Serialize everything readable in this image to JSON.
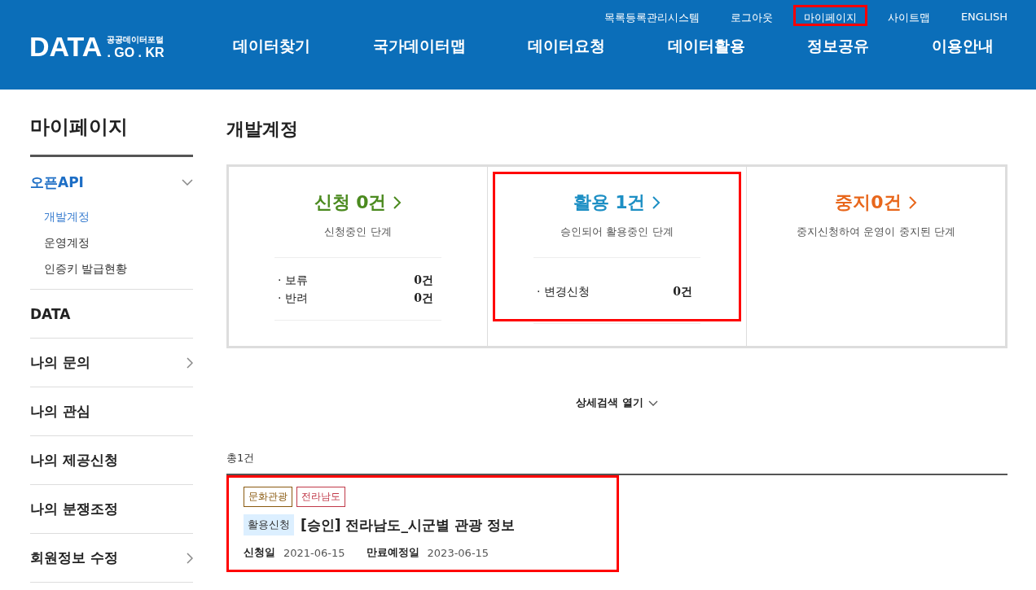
{
  "header": {
    "logo": {
      "word": "DATA",
      "subtitle": "공공데이터포털",
      "domain": ". GO . KR"
    },
    "top_links": [
      {
        "label": "목록등록관리시스템",
        "highlighted": false
      },
      {
        "label": "로그아웃",
        "highlighted": false
      },
      {
        "label": "마이페이지",
        "highlighted": true
      },
      {
        "label": "사이트맵",
        "highlighted": false
      },
      {
        "label": "ENGLISH",
        "highlighted": false
      }
    ],
    "nav": [
      "데이터찾기",
      "국가데이터맵",
      "데이터요청",
      "데이터활용",
      "정보공유",
      "이용안내"
    ]
  },
  "sidebar": {
    "title": "마이페이지",
    "items": [
      {
        "label": "오픈API",
        "expanded": true,
        "children": [
          {
            "label": "개발계정",
            "selected": true
          },
          {
            "label": "운영계정",
            "selected": false
          },
          {
            "label": "인증키 발급현황",
            "selected": false
          }
        ]
      },
      {
        "label": "DATA"
      },
      {
        "label": "나의 문의",
        "expanded": false
      },
      {
        "label": "나의 관심"
      },
      {
        "label": "나의 제공신청"
      },
      {
        "label": "나의 분쟁조정"
      },
      {
        "label": "회원정보 수정",
        "expanded": false
      }
    ]
  },
  "page_title": "개발계정",
  "stats": [
    {
      "title": "신청 0건",
      "color": "#4b8a1f",
      "description": "신청중인 단계",
      "highlighted": false,
      "rows": [
        {
          "label": "· 보류",
          "count": "0건"
        },
        {
          "label": "· 반려",
          "count": "0건"
        }
      ]
    },
    {
      "title": "활용 1건",
      "color": "#1d8fc4",
      "description": "승인되어 활용중인 단계",
      "highlighted": true,
      "rows": [
        {
          "label": "· 변경신청",
          "count": "0건"
        }
      ]
    },
    {
      "title": "중지0건",
      "color": "#e8671c",
      "description": "중지신청하여 운영이 중지된 단계",
      "highlighted": false
    }
  ],
  "detail_search": "상세검색 열기",
  "total": "총1건",
  "results": [
    {
      "tags": [
        {
          "label": "문화관광",
          "color": "#8a5a10"
        },
        {
          "label": "전라남도",
          "color": "#c03848"
        }
      ],
      "status": "활용신청",
      "title": "[승인] 전라남도_시군별 관광 정보",
      "highlighted": true,
      "dates": [
        {
          "label": "신청일",
          "value": "2021-06-15"
        },
        {
          "label": "만료예정일",
          "value": "2023-06-15"
        }
      ]
    }
  ]
}
